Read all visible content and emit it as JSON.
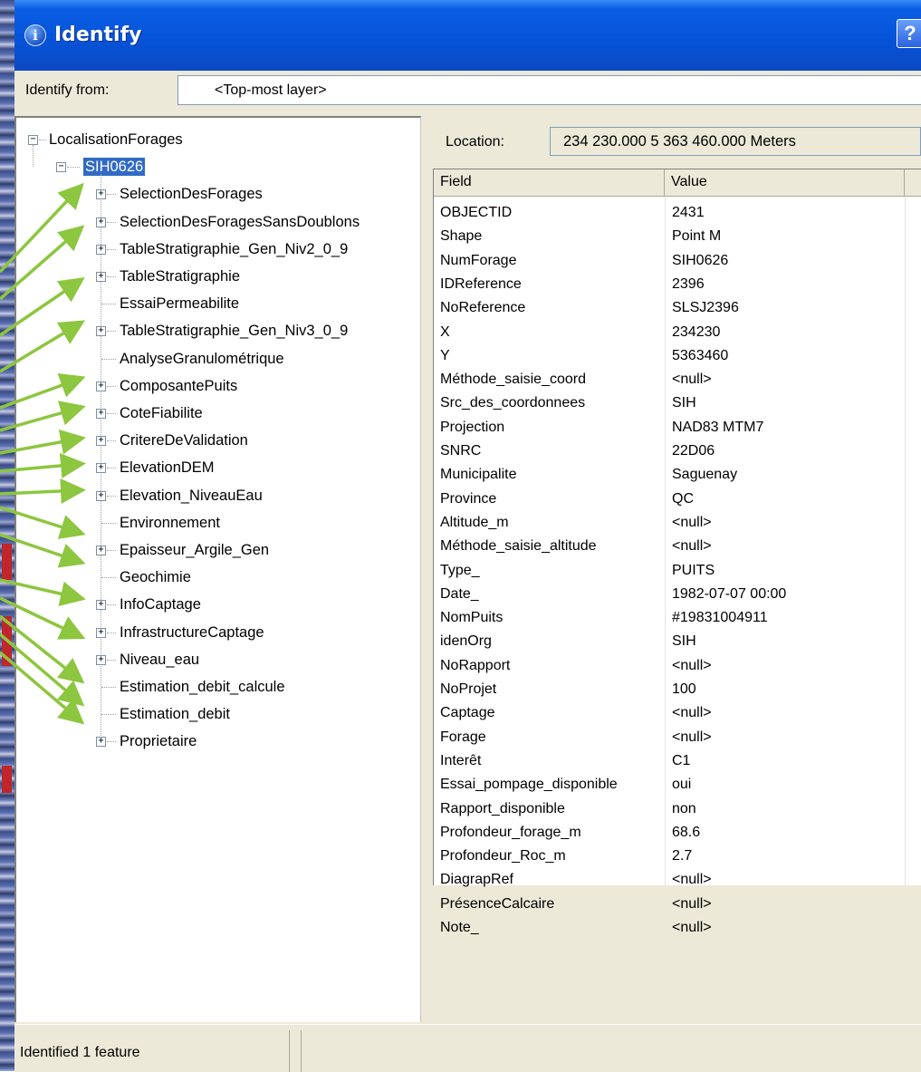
{
  "window": {
    "title": "Identify",
    "info_icon_glyph": "i",
    "help_glyph": "?"
  },
  "identify_from": {
    "label": "Identify from:",
    "value": "<Top-most layer>"
  },
  "tree": {
    "root": "LocalisationForages",
    "selected": "SIH0626",
    "children": [
      {
        "label": "SelectionDesForages",
        "expandable": true
      },
      {
        "label": "SelectionDesForagesSansDoublons",
        "expandable": true
      },
      {
        "label": "TableStratigraphie_Gen_Niv2_0_9",
        "expandable": true
      },
      {
        "label": "TableStratigraphie",
        "expandable": true
      },
      {
        "label": "EssaiPermeabilite",
        "expandable": false
      },
      {
        "label": "TableStratigraphie_Gen_Niv3_0_9",
        "expandable": true
      },
      {
        "label": "AnalyseGranulométrique",
        "expandable": false
      },
      {
        "label": "ComposantePuits",
        "expandable": true
      },
      {
        "label": "CoteFiabilite",
        "expandable": true
      },
      {
        "label": "CritereDeValidation",
        "expandable": true
      },
      {
        "label": "ElevationDEM",
        "expandable": true
      },
      {
        "label": "Elevation_NiveauEau",
        "expandable": true
      },
      {
        "label": "Environnement",
        "expandable": false
      },
      {
        "label": "Epaisseur_Argile_Gen",
        "expandable": true
      },
      {
        "label": "Geochimie",
        "expandable": false
      },
      {
        "label": "InfoCaptage",
        "expandable": true
      },
      {
        "label": "InfrastructureCaptage",
        "expandable": true
      },
      {
        "label": "Niveau_eau",
        "expandable": true
      },
      {
        "label": "Estimation_debit_calcule",
        "expandable": false
      },
      {
        "label": "Estimation_debit",
        "expandable": false
      },
      {
        "label": "Proprietaire",
        "expandable": true
      }
    ]
  },
  "location": {
    "label": "Location:",
    "value": "234 230.000  5 363 460.000 Meters"
  },
  "grid": {
    "headers": {
      "field": "Field",
      "value": "Value"
    },
    "rows": [
      {
        "field": "OBJECTID",
        "value": "2431"
      },
      {
        "field": "Shape",
        "value": "Point M"
      },
      {
        "field": "NumForage",
        "value": "SIH0626"
      },
      {
        "field": "IDReference",
        "value": "2396"
      },
      {
        "field": "NoReference",
        "value": "SLSJ2396"
      },
      {
        "field": "X",
        "value": "234230"
      },
      {
        "field": "Y",
        "value": "5363460"
      },
      {
        "field": "Méthode_saisie_coord",
        "value": "<null>"
      },
      {
        "field": "Src_des_coordonnees",
        "value": "SIH"
      },
      {
        "field": "Projection",
        "value": "NAD83 MTM7"
      },
      {
        "field": "SNRC",
        "value": "22D06"
      },
      {
        "field": "Municipalite",
        "value": "Saguenay"
      },
      {
        "field": "Province",
        "value": "QC"
      },
      {
        "field": "Altitude_m",
        "value": "<null>"
      },
      {
        "field": "Méthode_saisie_altitude",
        "value": "<null>"
      },
      {
        "field": "Type_",
        "value": "PUITS"
      },
      {
        "field": "Date_",
        "value": "1982-07-07 00:00"
      },
      {
        "field": "NomPuits",
        "value": "#19831004911"
      },
      {
        "field": "idenOrg",
        "value": "SIH"
      },
      {
        "field": "NoRapport",
        "value": "<null>"
      },
      {
        "field": "NoProjet",
        "value": "100"
      },
      {
        "field": "Captage",
        "value": "<null>"
      },
      {
        "field": "Forage",
        "value": "<null>"
      },
      {
        "field": "Interêt",
        "value": "C1"
      },
      {
        "field": "Essai_pompage_disponible",
        "value": "oui"
      },
      {
        "field": "Rapport_disponible",
        "value": "non"
      },
      {
        "field": "Profondeur_forage_m",
        "value": "68.6"
      },
      {
        "field": "Profondeur_Roc_m",
        "value": "2.7"
      },
      {
        "field": "DiagrapRef",
        "value": "<null>"
      },
      {
        "field": "PrésenceCalcaire",
        "value": "<null>"
      },
      {
        "field": "Note_",
        "value": "<null>"
      }
    ]
  },
  "status": {
    "text": "Identified 1 feature"
  },
  "colors": {
    "titlebar": "#0653d8",
    "selection": "#316ac5",
    "arrow": "#8dc63f",
    "dialog": "#ece9d8"
  }
}
